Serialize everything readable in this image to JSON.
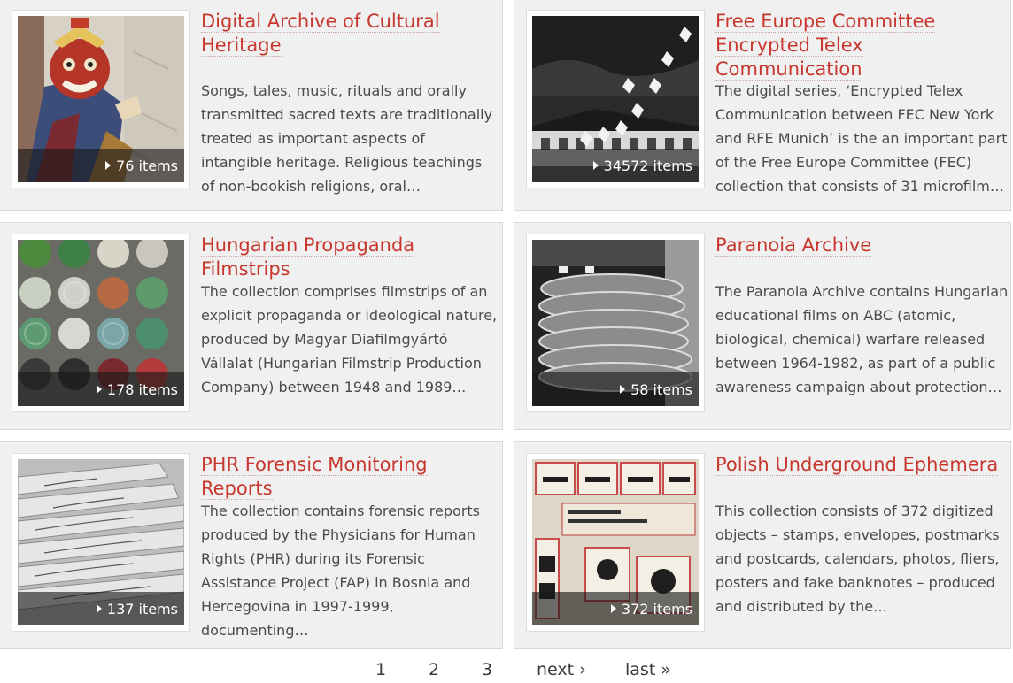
{
  "collections": [
    {
      "title": "Digital Archive of Cultural Heritage",
      "description": "Songs, tales, music, rituals and orally transmitted sacred texts are traditionally treated as important aspects of intangible heritage. Religious teachings of non-bookish religions, oral…",
      "count_label": "76 items",
      "thumb_icon": "ritual-mask-photo"
    },
    {
      "title": "Free Europe Committee Encrypted Telex Communication",
      "description": "The digital series, ‘Encrypted Telex Communication between FEC New York and RFE Munich’ is the an important part of the Free Europe Committee (FEC) collection that consists of 31 microfilm…",
      "count_label": "34572 items",
      "thumb_icon": "balloons-over-building-photo"
    },
    {
      "title": "Hungarian Propaganda Filmstrips",
      "description": "The collection comprises filmstrips of an explicit propaganda or ideological nature, produced by Magyar Diafilmgyártó Vállalat (Hungarian Filmstrip Production Company) between 1948 and 1989…",
      "count_label": "178 items",
      "thumb_icon": "filmstrip-canisters-photo"
    },
    {
      "title": "Paranoia Archive",
      "description": "The Paranoia Archive contains Hungarian educational films on ABC (atomic, biological, chemical) warfare released between 1964-1982, as part of a public awareness campaign about protection…",
      "count_label": "58 items",
      "thumb_icon": "film-reels-photo"
    },
    {
      "title": "PHR Forensic Monitoring Reports",
      "description": "The collection contains forensic reports produced by the Physicians for Human Rights (PHR) during its Forensic Assistance Project (FAP) in Bosnia and Hercegovina in 1997-1999, documenting…",
      "count_label": "137 items",
      "thumb_icon": "file-index-cards-photo"
    },
    {
      "title": "Polish Underground Ephemera",
      "description": "This collection consists of 372 digitized objects – stamps, envelopes, postmarks and postcards, calendars, photos, fliers, posters and fake banknotes – produced and distributed by the…",
      "count_label": "372 items",
      "thumb_icon": "stamps-photo"
    }
  ],
  "pagination": {
    "page1": "1",
    "page2": "2",
    "page3": "3",
    "next": "next ›",
    "last": "last »"
  },
  "colors": {
    "title": "#c8372d",
    "text": "#4a4a4a",
    "card_bg": "#f0f0f0",
    "overlay": "#191919"
  }
}
